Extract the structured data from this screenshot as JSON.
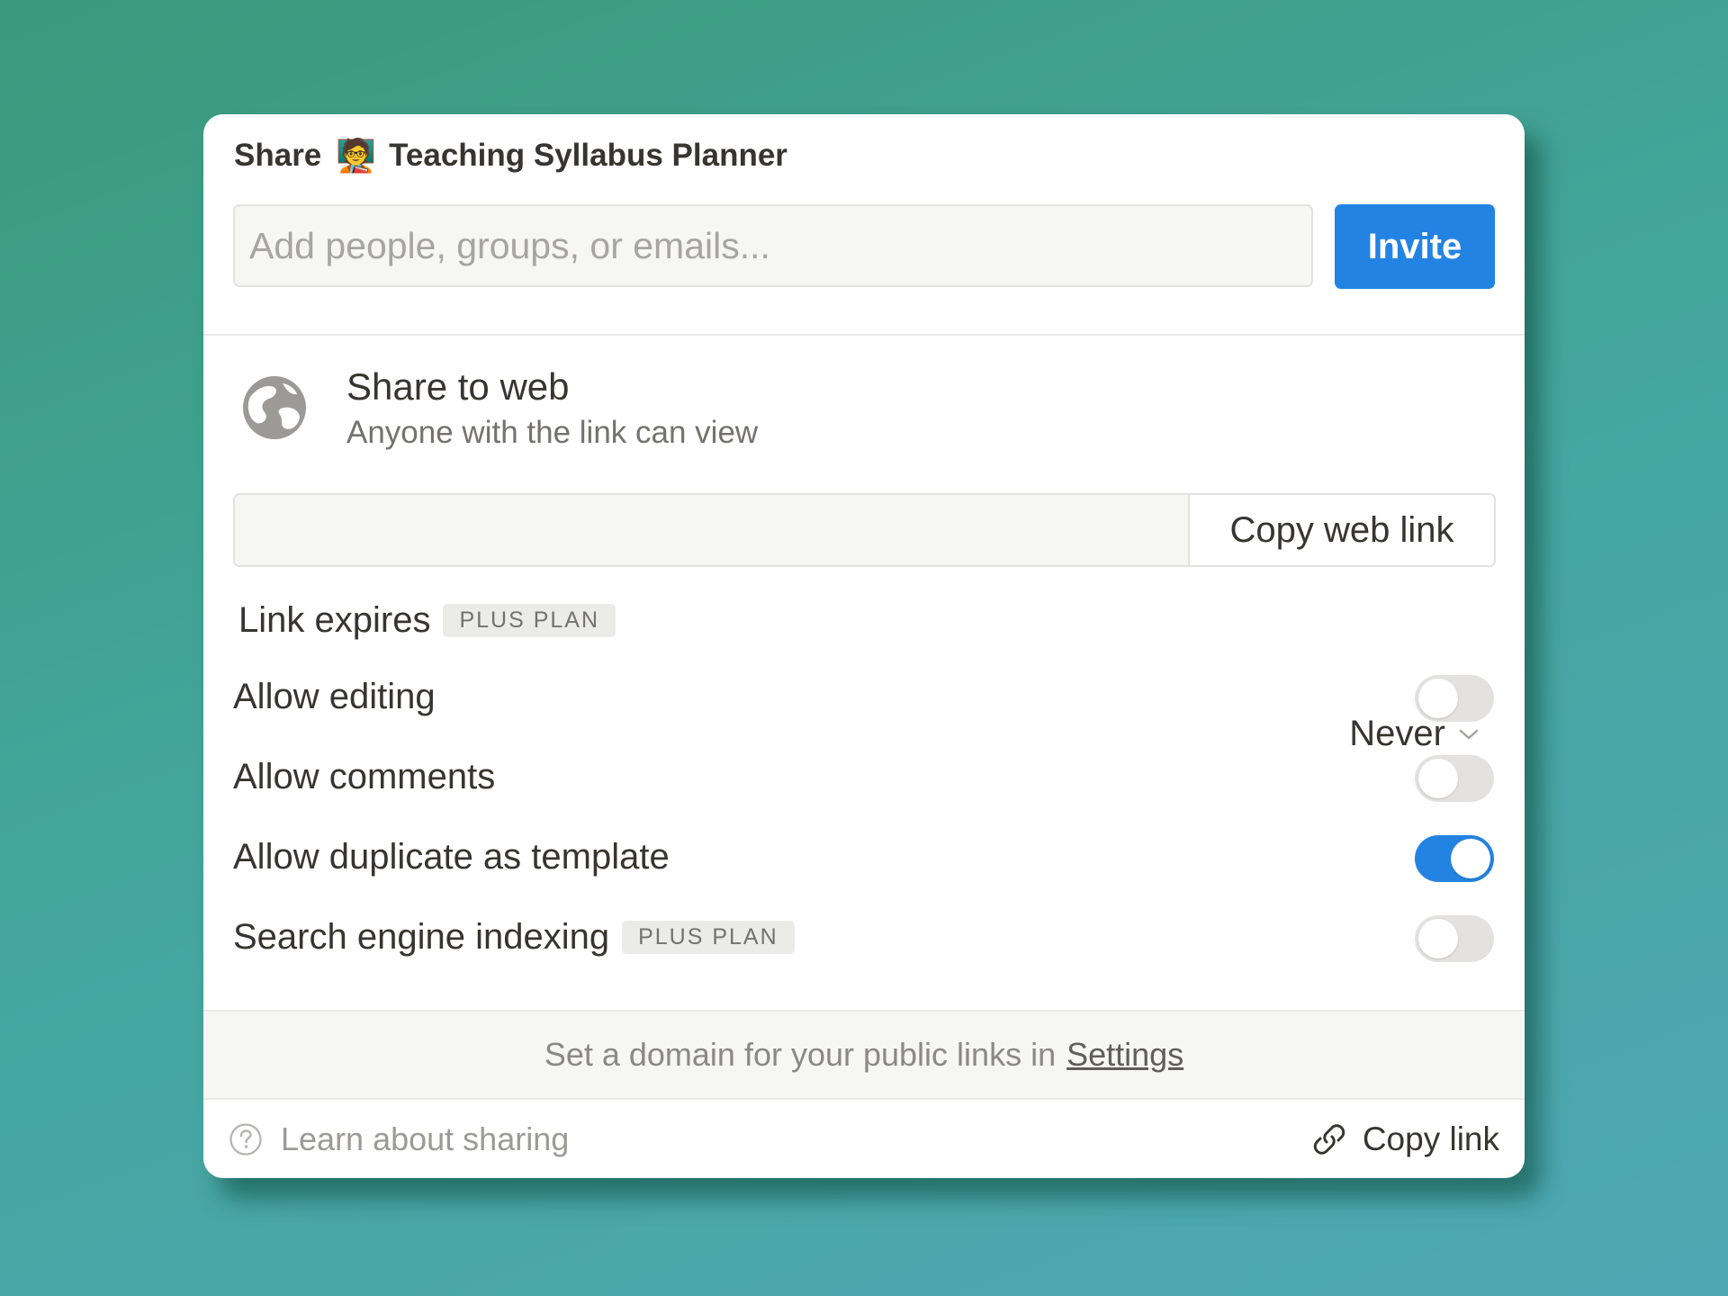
{
  "dialog": {
    "header": {
      "share_label": "Share",
      "page_emoji": "🧑‍🏫",
      "page_title": "Teaching Syllabus Planner"
    },
    "invite": {
      "placeholder": "Add people, groups, or emails...",
      "button_label": "Invite"
    },
    "share_to_web": {
      "title": "Share to web",
      "subtitle": "Anyone with the link can view",
      "enabled": true,
      "copy_web_link_label": "Copy web link"
    },
    "link_expires": {
      "label": "Link expires",
      "badge": "PLUS PLAN",
      "value": "Never"
    },
    "options": [
      {
        "label": "Allow editing",
        "enabled": false
      },
      {
        "label": "Allow comments",
        "enabled": false
      },
      {
        "label": "Allow duplicate as template",
        "enabled": true
      },
      {
        "label": "Search engine indexing",
        "badge": "PLUS PLAN",
        "enabled": false
      }
    ],
    "domain_note": {
      "text": "Set a domain for your public links in",
      "link": "Settings"
    },
    "footer": {
      "learn_label": "Learn about sharing",
      "copy_link_label": "Copy link"
    },
    "icons": [
      "globe-icon",
      "chevron-down-icon",
      "help-circle-icon",
      "link-icon"
    ],
    "colors": {
      "accent": "#2383e2",
      "toggle_off": "#e3e2e0",
      "text": "#37352f"
    }
  }
}
